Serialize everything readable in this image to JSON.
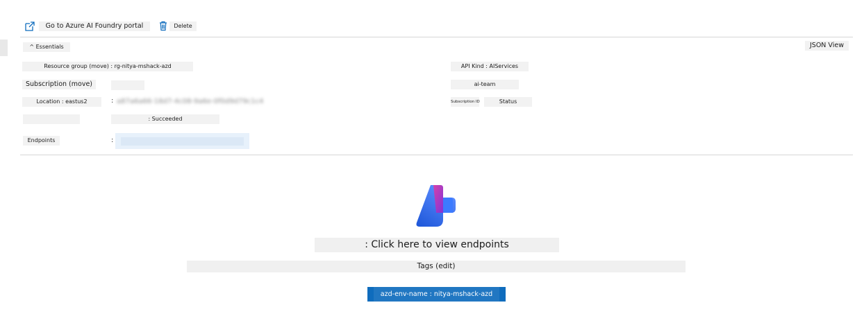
{
  "toolbar": {
    "open_portal_label": "Go to Azure AI Foundry portal",
    "delete_label": "Delete"
  },
  "essentials": {
    "toggle_label": "^ Essentials",
    "json_view_label": "JSON View",
    "resource_group": "Resource group (move) : rg-nitya-mshack-azd",
    "api_kind": "API Kind : AIServices",
    "subscription_label": "Subscription (move)",
    "subscription_value": "ai-team",
    "location": "Location : eastus2",
    "subscription_id_label": "Subscription ID",
    "subscription_id_value": "a87a6a66-18d7-4c08-9a6e-0f0d9d79c1c4",
    "status_label": "Status",
    "status_value": ": Succeeded",
    "endpoints_label": "Endpoints",
    "separator": ":"
  },
  "main": {
    "endpoints_link": ": Click here to view endpoints",
    "tags_label": "Tags (edit)",
    "tag": "azd-env-name : nitya-mshack-azd"
  },
  "colors": {
    "accent": "#0f6cbd",
    "chip_bg": "#f2f2f2"
  },
  "icons": {
    "open_portal": "external-link-icon",
    "delete": "trash-icon",
    "logo": "azure-ai-foundry-logo"
  }
}
